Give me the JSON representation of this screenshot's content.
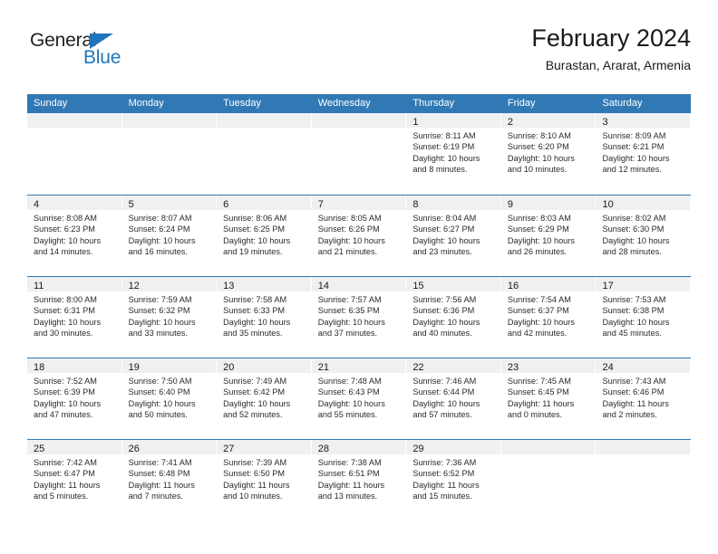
{
  "brand": {
    "name_top": "General",
    "name_bottom": "Blue",
    "triangle_color": "#1f76bc",
    "text_color": "#231f20"
  },
  "header": {
    "title": "February 2024",
    "subtitle": "Burastan, Ararat, Armenia"
  },
  "theme": {
    "header_blue": "#3179b5",
    "daynum_band": "#f0f0f0",
    "text": "#2b2b2b"
  },
  "weekdays": [
    "Sunday",
    "Monday",
    "Tuesday",
    "Wednesday",
    "Thursday",
    "Friday",
    "Saturday"
  ],
  "labels": {
    "sunrise_prefix": "Sunrise:",
    "sunset_prefix": "Sunset:",
    "daylight_prefix": "Daylight:"
  },
  "weeks": [
    [
      {
        "day": "",
        "empty": true,
        "line1": "",
        "line2": "",
        "line3": "",
        "line4": ""
      },
      {
        "day": "",
        "empty": true,
        "line1": "",
        "line2": "",
        "line3": "",
        "line4": ""
      },
      {
        "day": "",
        "empty": true,
        "line1": "",
        "line2": "",
        "line3": "",
        "line4": ""
      },
      {
        "day": "",
        "empty": true,
        "line1": "",
        "line2": "",
        "line3": "",
        "line4": ""
      },
      {
        "day": "1",
        "empty": false,
        "line1": "Sunrise: 8:11 AM",
        "line2": "Sunset: 6:19 PM",
        "line3": "Daylight: 10 hours",
        "line4": "and 8 minutes."
      },
      {
        "day": "2",
        "empty": false,
        "line1": "Sunrise: 8:10 AM",
        "line2": "Sunset: 6:20 PM",
        "line3": "Daylight: 10 hours",
        "line4": "and 10 minutes."
      },
      {
        "day": "3",
        "empty": false,
        "line1": "Sunrise: 8:09 AM",
        "line2": "Sunset: 6:21 PM",
        "line3": "Daylight: 10 hours",
        "line4": "and 12 minutes."
      }
    ],
    [
      {
        "day": "4",
        "empty": false,
        "line1": "Sunrise: 8:08 AM",
        "line2": "Sunset: 6:23 PM",
        "line3": "Daylight: 10 hours",
        "line4": "and 14 minutes."
      },
      {
        "day": "5",
        "empty": false,
        "line1": "Sunrise: 8:07 AM",
        "line2": "Sunset: 6:24 PM",
        "line3": "Daylight: 10 hours",
        "line4": "and 16 minutes."
      },
      {
        "day": "6",
        "empty": false,
        "line1": "Sunrise: 8:06 AM",
        "line2": "Sunset: 6:25 PM",
        "line3": "Daylight: 10 hours",
        "line4": "and 19 minutes."
      },
      {
        "day": "7",
        "empty": false,
        "line1": "Sunrise: 8:05 AM",
        "line2": "Sunset: 6:26 PM",
        "line3": "Daylight: 10 hours",
        "line4": "and 21 minutes."
      },
      {
        "day": "8",
        "empty": false,
        "line1": "Sunrise: 8:04 AM",
        "line2": "Sunset: 6:27 PM",
        "line3": "Daylight: 10 hours",
        "line4": "and 23 minutes."
      },
      {
        "day": "9",
        "empty": false,
        "line1": "Sunrise: 8:03 AM",
        "line2": "Sunset: 6:29 PM",
        "line3": "Daylight: 10 hours",
        "line4": "and 26 minutes."
      },
      {
        "day": "10",
        "empty": false,
        "line1": "Sunrise: 8:02 AM",
        "line2": "Sunset: 6:30 PM",
        "line3": "Daylight: 10 hours",
        "line4": "and 28 minutes."
      }
    ],
    [
      {
        "day": "11",
        "empty": false,
        "line1": "Sunrise: 8:00 AM",
        "line2": "Sunset: 6:31 PM",
        "line3": "Daylight: 10 hours",
        "line4": "and 30 minutes."
      },
      {
        "day": "12",
        "empty": false,
        "line1": "Sunrise: 7:59 AM",
        "line2": "Sunset: 6:32 PM",
        "line3": "Daylight: 10 hours",
        "line4": "and 33 minutes."
      },
      {
        "day": "13",
        "empty": false,
        "line1": "Sunrise: 7:58 AM",
        "line2": "Sunset: 6:33 PM",
        "line3": "Daylight: 10 hours",
        "line4": "and 35 minutes."
      },
      {
        "day": "14",
        "empty": false,
        "line1": "Sunrise: 7:57 AM",
        "line2": "Sunset: 6:35 PM",
        "line3": "Daylight: 10 hours",
        "line4": "and 37 minutes."
      },
      {
        "day": "15",
        "empty": false,
        "line1": "Sunrise: 7:56 AM",
        "line2": "Sunset: 6:36 PM",
        "line3": "Daylight: 10 hours",
        "line4": "and 40 minutes."
      },
      {
        "day": "16",
        "empty": false,
        "line1": "Sunrise: 7:54 AM",
        "line2": "Sunset: 6:37 PM",
        "line3": "Daylight: 10 hours",
        "line4": "and 42 minutes."
      },
      {
        "day": "17",
        "empty": false,
        "line1": "Sunrise: 7:53 AM",
        "line2": "Sunset: 6:38 PM",
        "line3": "Daylight: 10 hours",
        "line4": "and 45 minutes."
      }
    ],
    [
      {
        "day": "18",
        "empty": false,
        "line1": "Sunrise: 7:52 AM",
        "line2": "Sunset: 6:39 PM",
        "line3": "Daylight: 10 hours",
        "line4": "and 47 minutes."
      },
      {
        "day": "19",
        "empty": false,
        "line1": "Sunrise: 7:50 AM",
        "line2": "Sunset: 6:40 PM",
        "line3": "Daylight: 10 hours",
        "line4": "and 50 minutes."
      },
      {
        "day": "20",
        "empty": false,
        "line1": "Sunrise: 7:49 AM",
        "line2": "Sunset: 6:42 PM",
        "line3": "Daylight: 10 hours",
        "line4": "and 52 minutes."
      },
      {
        "day": "21",
        "empty": false,
        "line1": "Sunrise: 7:48 AM",
        "line2": "Sunset: 6:43 PM",
        "line3": "Daylight: 10 hours",
        "line4": "and 55 minutes."
      },
      {
        "day": "22",
        "empty": false,
        "line1": "Sunrise: 7:46 AM",
        "line2": "Sunset: 6:44 PM",
        "line3": "Daylight: 10 hours",
        "line4": "and 57 minutes."
      },
      {
        "day": "23",
        "empty": false,
        "line1": "Sunrise: 7:45 AM",
        "line2": "Sunset: 6:45 PM",
        "line3": "Daylight: 11 hours",
        "line4": "and 0 minutes."
      },
      {
        "day": "24",
        "empty": false,
        "line1": "Sunrise: 7:43 AM",
        "line2": "Sunset: 6:46 PM",
        "line3": "Daylight: 11 hours",
        "line4": "and 2 minutes."
      }
    ],
    [
      {
        "day": "25",
        "empty": false,
        "line1": "Sunrise: 7:42 AM",
        "line2": "Sunset: 6:47 PM",
        "line3": "Daylight: 11 hours",
        "line4": "and 5 minutes."
      },
      {
        "day": "26",
        "empty": false,
        "line1": "Sunrise: 7:41 AM",
        "line2": "Sunset: 6:48 PM",
        "line3": "Daylight: 11 hours",
        "line4": "and 7 minutes."
      },
      {
        "day": "27",
        "empty": false,
        "line1": "Sunrise: 7:39 AM",
        "line2": "Sunset: 6:50 PM",
        "line3": "Daylight: 11 hours",
        "line4": "and 10 minutes."
      },
      {
        "day": "28",
        "empty": false,
        "line1": "Sunrise: 7:38 AM",
        "line2": "Sunset: 6:51 PM",
        "line3": "Daylight: 11 hours",
        "line4": "and 13 minutes."
      },
      {
        "day": "29",
        "empty": false,
        "line1": "Sunrise: 7:36 AM",
        "line2": "Sunset: 6:52 PM",
        "line3": "Daylight: 11 hours",
        "line4": "and 15 minutes."
      },
      {
        "day": "",
        "empty": true,
        "line1": "",
        "line2": "",
        "line3": "",
        "line4": ""
      },
      {
        "day": "",
        "empty": true,
        "line1": "",
        "line2": "",
        "line3": "",
        "line4": ""
      }
    ]
  ]
}
